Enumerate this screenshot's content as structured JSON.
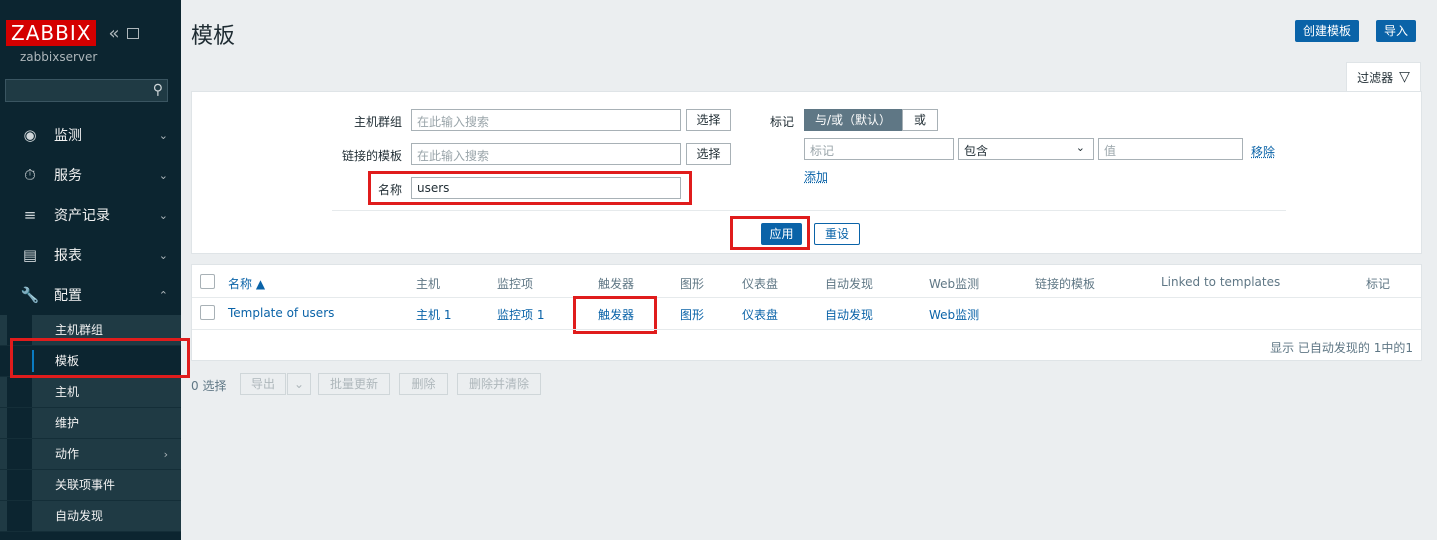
{
  "sidebar": {
    "logo": "ZABBIX",
    "collapse_glyph": "«",
    "server_name": "zabbixserver",
    "menu": [
      {
        "label": "监测",
        "icon": "eye-icon"
      },
      {
        "label": "服务",
        "icon": "clock-icon"
      },
      {
        "label": "资产记录",
        "icon": "list-icon"
      },
      {
        "label": "报表",
        "icon": "bar-chart-icon"
      },
      {
        "label": "配置",
        "icon": "wrench-icon"
      }
    ],
    "submenu": [
      "主机群组",
      "模板",
      "主机",
      "维护",
      "动作",
      "关联项事件",
      "自动发现"
    ]
  },
  "header": {
    "title": "模板",
    "create_button": "创建模板",
    "import_button": "导入"
  },
  "filter": {
    "tab_label": "过滤器",
    "host_group_label": "主机群组",
    "host_group_placeholder": "在此输入搜索",
    "linked_templates_label": "链接的模板",
    "linked_templates_placeholder": "在此输入搜索",
    "name_label": "名称",
    "name_value": "users",
    "select_button": "选择",
    "tags_label": "标记",
    "tags_mode_andor": "与/或（默认）",
    "tags_mode_or": "或",
    "tag_placeholder": "标记",
    "tag_operator": "包含",
    "value_placeholder": "值",
    "remove_link": "移除",
    "add_link": "添加",
    "apply_button": "应用",
    "reset_button": "重设"
  },
  "table": {
    "headers": [
      "名称 ▲",
      "主机",
      "监控项",
      "触发器",
      "图形",
      "仪表盘",
      "自动发现",
      "Web监测",
      "链接的模板",
      "Linked to templates",
      "标记"
    ],
    "rows": [
      {
        "name": "Template of users",
        "hosts": "主机 1",
        "items": "监控项 1",
        "triggers": "触发器",
        "graphs": "图形",
        "dashboards": "仪表盘",
        "discovery": "自动发现",
        "web": "Web监测"
      }
    ],
    "footer": "显示 已自动发现的 1中的1"
  },
  "actions": {
    "selected": "0 选择",
    "export": "导出",
    "mass_update": "批量更新",
    "delete": "删除",
    "delete_clear": "删除并清除"
  }
}
